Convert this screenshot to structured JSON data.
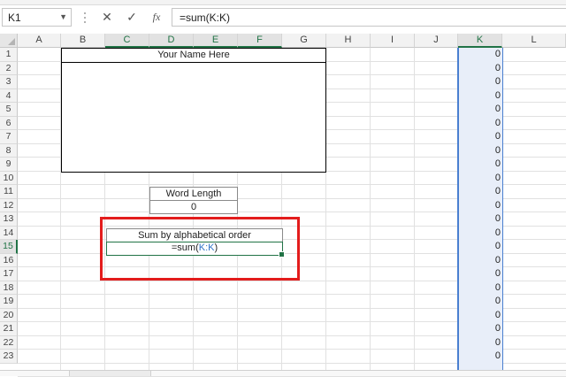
{
  "formula_bar": {
    "name_box": "K1",
    "cancel_icon": "✕",
    "enter_icon": "✓",
    "function_icon": "fx",
    "formula": "=sum(K:K)"
  },
  "columns": [
    "A",
    "B",
    "C",
    "D",
    "E",
    "F",
    "G",
    "H",
    "I",
    "J",
    "K",
    "L"
  ],
  "highlighted_columns": [
    "C",
    "D",
    "E",
    "F",
    "K"
  ],
  "rows": [
    "1",
    "2",
    "3",
    "4",
    "5",
    "6",
    "7",
    "8",
    "9",
    "10",
    "11",
    "12",
    "13",
    "14",
    "15",
    "16",
    "17",
    "18",
    "19",
    "20",
    "21",
    "22",
    "23"
  ],
  "highlighted_rows": [
    "15"
  ],
  "column_k_values": [
    "0",
    "0",
    "0",
    "0",
    "0",
    "0",
    "0",
    "0",
    "0",
    "0",
    "0",
    "0",
    "0",
    "0",
    "0",
    "0",
    "0",
    "0",
    "0",
    "0",
    "0",
    "0",
    "0"
  ],
  "name_table": {
    "title": "Your Name Here"
  },
  "word_length": {
    "label": "Word Length",
    "value": "0"
  },
  "sum_box": {
    "label": "Sum by alphabetical order",
    "formula_prefix": "=sum(",
    "formula_ref": "K:K",
    "formula_suffix": ")"
  },
  "colors": {
    "selection_green": "#217346",
    "annotation_red": "#e31c1c",
    "ref_blue": "#2f73c9",
    "column_highlight": "#e8eef9"
  }
}
